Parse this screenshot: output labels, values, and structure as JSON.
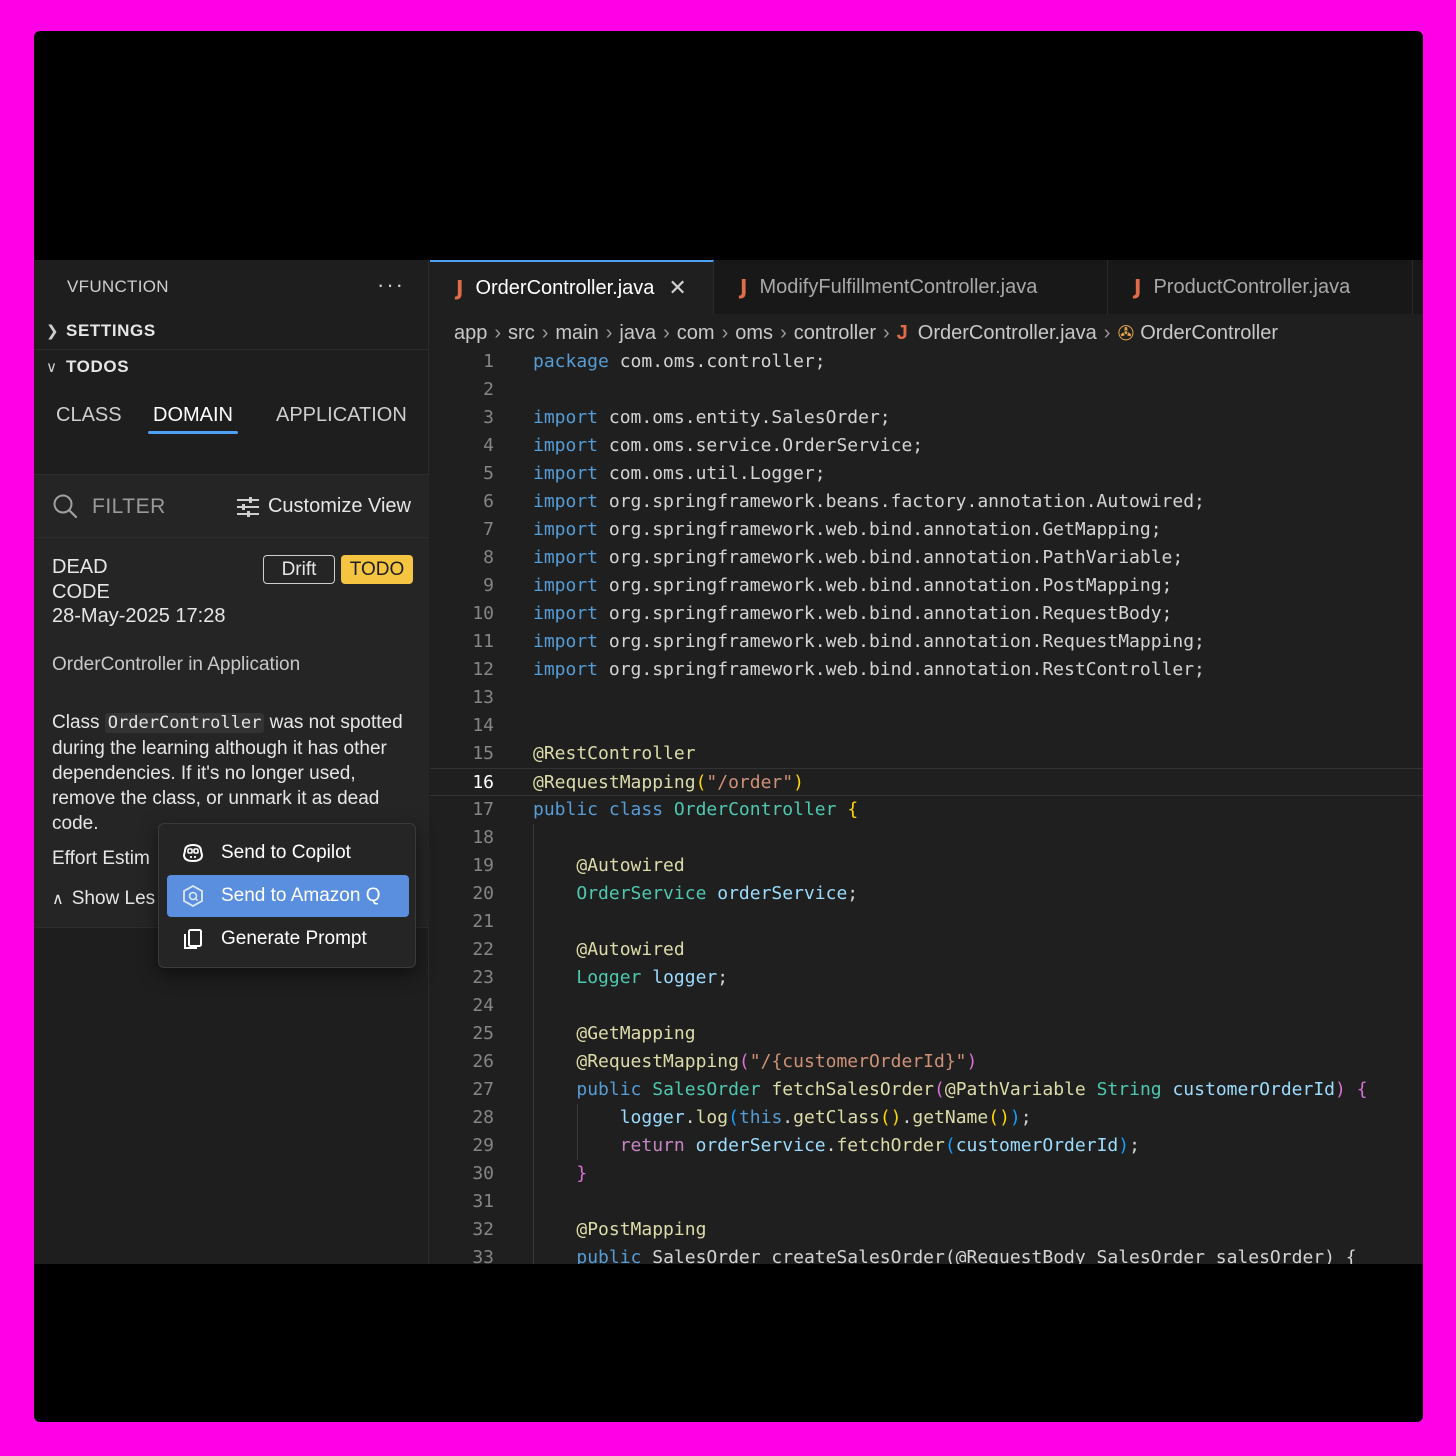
{
  "sidebar": {
    "title": "VFUNCTION",
    "more": "···",
    "settings": "SETTINGS",
    "todos": "TODOS",
    "tabs": [
      "CLASS",
      "DOMAIN",
      "APPLICATION"
    ],
    "active_tab": "DOMAIN",
    "filter_placeholder": "FILTER",
    "customize_view": "Customize View"
  },
  "card": {
    "type_line1": "DEAD",
    "type_line2": "CODE",
    "badge_drift": "Drift",
    "badge_todo": "TODO",
    "date": "28-May-2025 17:28",
    "context": "OrderController in Application",
    "desc_prefix": "Class ",
    "desc_code": "OrderController",
    "desc_suffix": " was not spotted during the learning although it has other dependencies. If it's no longer used, remove the class, or unmark it as dead code.",
    "effort": "Effort Estim",
    "show_less": "Show Les"
  },
  "context_menu": {
    "items": [
      "Send to Copilot",
      "Send to Amazon Q",
      "Generate Prompt"
    ],
    "selected": "Send to Amazon Q"
  },
  "editor": {
    "tabs": [
      "OrderController.java",
      "ModifyFulfillmentController.java",
      "ProductController.java"
    ],
    "active_tab": "OrderController.java",
    "breadcrumbs": [
      "app",
      "src",
      "main",
      "java",
      "com",
      "oms",
      "controller",
      "OrderController.java",
      "OrderController"
    ],
    "current_line": 16,
    "colors": {
      "accent": "#4ea0f5",
      "todo_badge": "#f5c542",
      "menu_selected": "#5a8fe0",
      "frame": "#ff00e6"
    }
  }
}
